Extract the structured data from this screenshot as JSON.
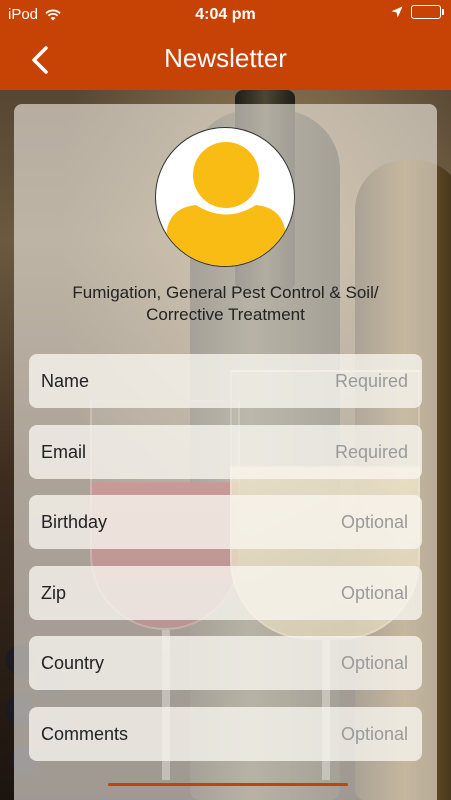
{
  "status_bar": {
    "carrier": "iPod",
    "time": "4:04 pm"
  },
  "nav": {
    "title": "Newsletter",
    "back_icon": "chevron-left-icon"
  },
  "profile": {
    "avatar_icon": "user-icon",
    "avatar_color": "#f9bc15",
    "company": "Fumigation, General Pest Control & Soil/ Corrective Treatment"
  },
  "form": {
    "fields": [
      {
        "label": "Name",
        "placeholder": "Required"
      },
      {
        "label": "Email",
        "placeholder": "Required"
      },
      {
        "label": "Birthday",
        "placeholder": "Optional"
      },
      {
        "label": "Zip",
        "placeholder": "Optional"
      },
      {
        "label": "Country",
        "placeholder": "Optional"
      },
      {
        "label": "Comments",
        "placeholder": "Optional"
      }
    ]
  },
  "colors": {
    "header": "#c74205",
    "text": "#222222",
    "placeholder": "#9a9a9a"
  }
}
